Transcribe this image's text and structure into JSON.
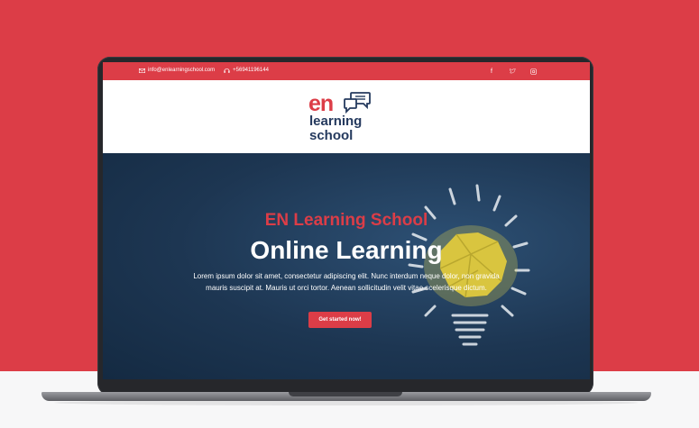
{
  "topbar": {
    "email": "info@enlearningschool.com",
    "phone": "+56941196144",
    "social": [
      {
        "icon": "facebook-icon",
        "glyph": "f"
      },
      {
        "icon": "twitter-icon",
        "glyph": "t"
      },
      {
        "icon": "instagram-icon",
        "glyph": "◻"
      }
    ]
  },
  "logo": {
    "line1": "en",
    "line2": "learning",
    "line3": "school"
  },
  "hero": {
    "subtitle": "EN Learning School",
    "title": "Online Learning",
    "description": "Lorem ipsum dolor sit amet, consectetur adipiscing elit. Nunc interdum neque dolor, non gravida mauris suscipit at. Mauris ut orci tortor. Aenean sollicitudin velit vitae scelerisque dictum.",
    "cta_label": "Get started now!"
  },
  "colors": {
    "brand_red": "#dc3d47",
    "navy": "#253a5e",
    "hero_bg": "#1f3a57"
  }
}
